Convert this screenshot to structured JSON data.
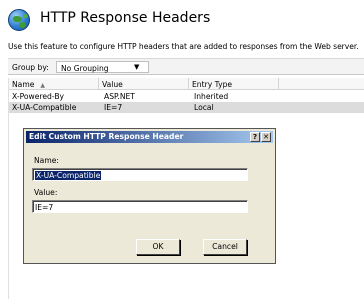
{
  "header": {
    "title": "HTTP Response Headers",
    "icon": "globe-icon"
  },
  "description": "Use this feature to configure HTTP headers that are added to responses from the Web server.",
  "group_by": {
    "label": "Group by:",
    "value": "No Grouping"
  },
  "list": {
    "columns": [
      "Name",
      "Value",
      "Entry Type"
    ],
    "sorted_column": "Name",
    "rows": [
      {
        "name": "X-Powered-By",
        "value": "ASP.NET",
        "entry_type": "Inherited",
        "selected": false
      },
      {
        "name": "X-UA-Compatible",
        "value": "IE=7",
        "entry_type": "Local",
        "selected": true
      }
    ]
  },
  "dialog": {
    "title": "Edit Custom HTTP Response Header",
    "help_label": "?",
    "close_label": "✕",
    "name_label": "Name:",
    "name_value": "X-UA-Compatible",
    "value_label": "Value:",
    "value_value": "IE=7",
    "ok_label": "OK",
    "cancel_label": "Cancel"
  },
  "colors": {
    "titlebar_start": "#0a246a",
    "titlebar_end": "#a6caf0",
    "selection": "#dcdcdc",
    "dialog_face": "#ece9d8"
  }
}
